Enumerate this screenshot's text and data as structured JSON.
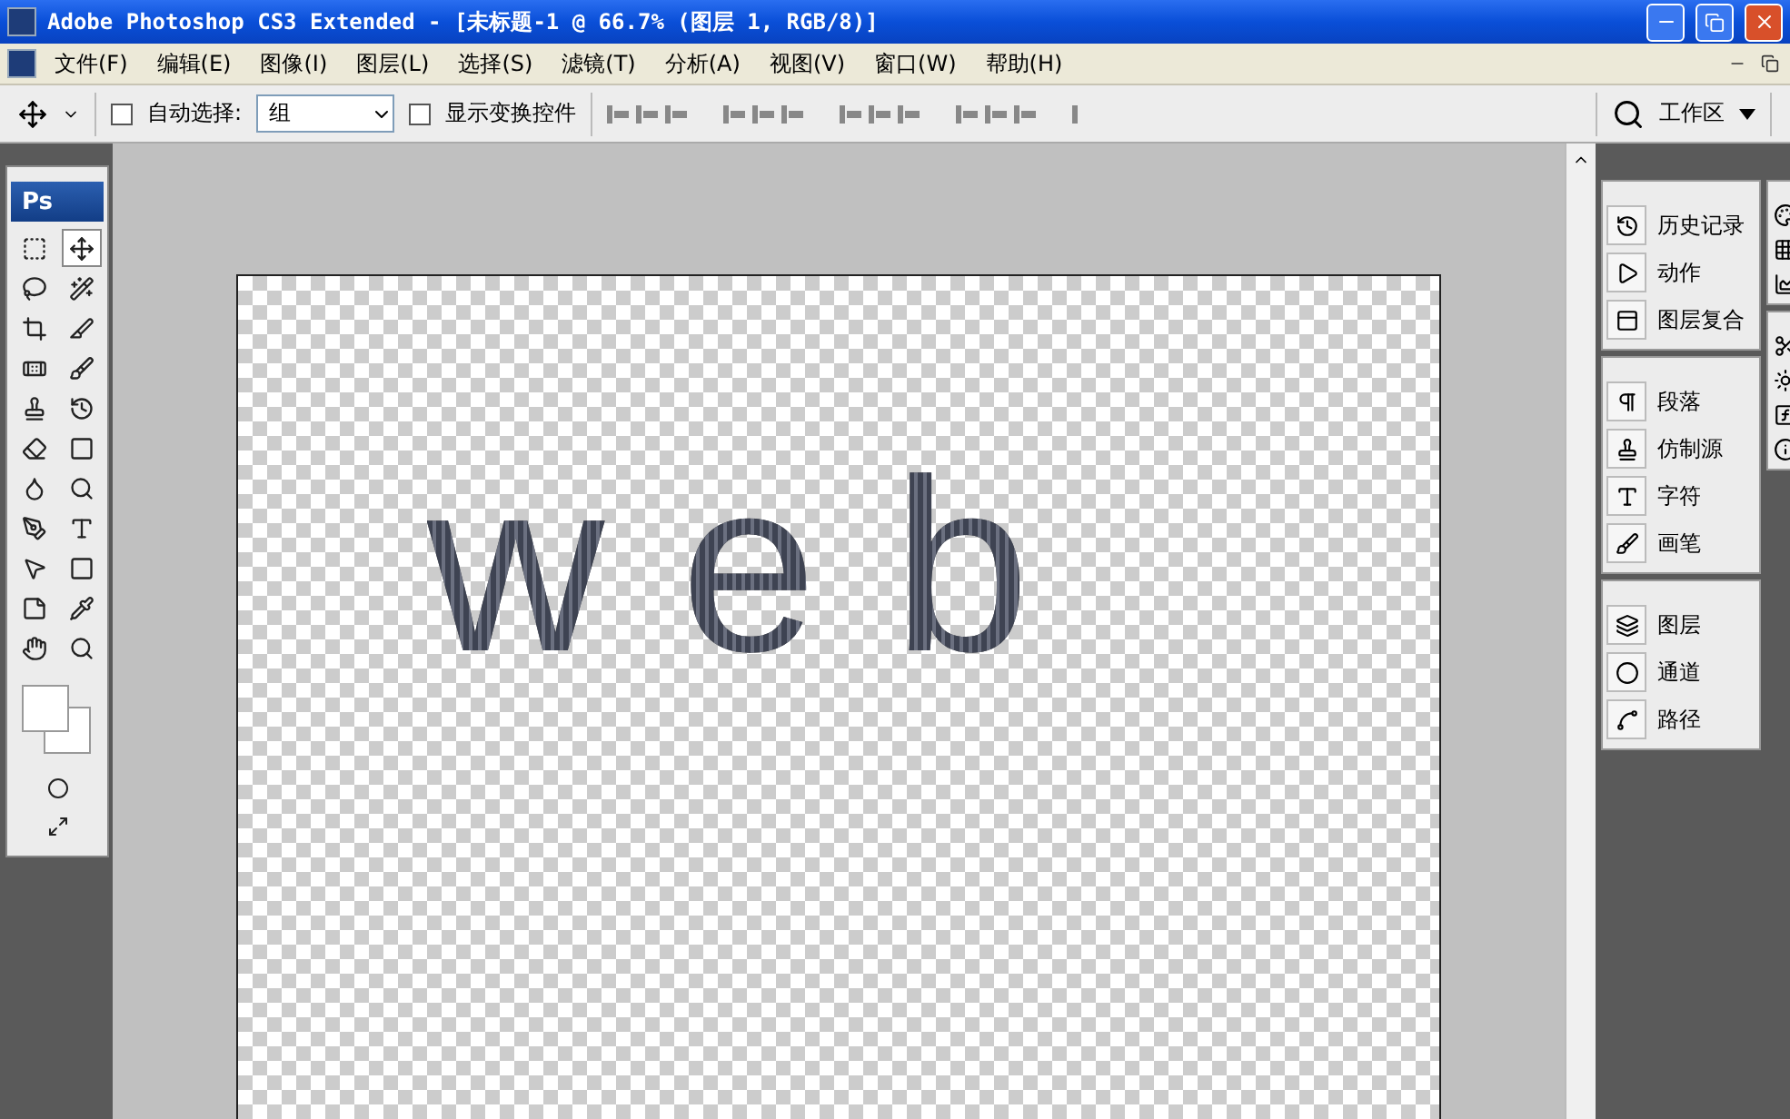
{
  "window": {
    "title": "Adobe Photoshop CS3 Extended - [未标题-1 @ 66.7% (图层 1, RGB/8)]"
  },
  "menu": [
    "文件(F)",
    "编辑(E)",
    "图像(I)",
    "图层(L)",
    "选择(S)",
    "滤镜(T)",
    "分析(A)",
    "视图(V)",
    "窗口(W)",
    "帮助(H)"
  ],
  "options_bar": {
    "auto_select": {
      "label": "自动选择:",
      "checked": false
    },
    "auto_select_value": "组",
    "transform_controls": {
      "label": "显示变换控件",
      "checked": false
    },
    "workspace": "工作区"
  },
  "toolbox": {
    "logo": "Ps",
    "tools": [
      {
        "kind": "marquee",
        "selected": false
      },
      {
        "kind": "move",
        "selected": true
      },
      {
        "kind": "lasso",
        "selected": false
      },
      {
        "kind": "wand",
        "selected": false
      },
      {
        "kind": "crop",
        "selected": false
      },
      {
        "kind": "slice",
        "selected": false
      },
      {
        "kind": "heal",
        "selected": false
      },
      {
        "kind": "brush",
        "selected": false
      },
      {
        "kind": "stamp",
        "selected": false
      },
      {
        "kind": "history_brush",
        "selected": false
      },
      {
        "kind": "eraser",
        "selected": false
      },
      {
        "kind": "gradient",
        "selected": false
      },
      {
        "kind": "blur",
        "selected": false
      },
      {
        "kind": "dodge",
        "selected": false
      },
      {
        "kind": "pen",
        "selected": false
      },
      {
        "kind": "type",
        "selected": false
      },
      {
        "kind": "path_select",
        "selected": false
      },
      {
        "kind": "shape",
        "selected": false
      },
      {
        "kind": "notes",
        "selected": false
      },
      {
        "kind": "eyedropper",
        "selected": false
      },
      {
        "kind": "hand",
        "selected": false
      },
      {
        "kind": "zoom",
        "selected": false
      }
    ]
  },
  "canvas": {
    "text": "web"
  },
  "panels": [
    {
      "items": [
        {
          "kind": "history",
          "label": "历史记录"
        },
        {
          "kind": "actions",
          "label": "动作"
        },
        {
          "kind": "layer_comps",
          "label": "图层复合"
        }
      ]
    },
    {
      "items": [
        {
          "kind": "paragraph",
          "label": "段落"
        },
        {
          "kind": "clone_source",
          "label": "仿制源"
        },
        {
          "kind": "character",
          "label": "字符"
        },
        {
          "kind": "brushes",
          "label": "画笔"
        }
      ]
    },
    {
      "items": [
        {
          "kind": "layers",
          "label": "图层"
        },
        {
          "kind": "channels",
          "label": "通道"
        },
        {
          "kind": "paths",
          "label": "路径"
        }
      ]
    }
  ]
}
